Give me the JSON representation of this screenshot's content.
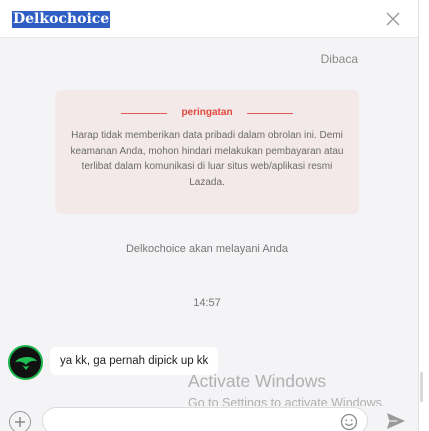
{
  "header": {
    "shop_name": "Delkochoice",
    "close_icon": "close-icon"
  },
  "conversation": {
    "read_status": "Dibaca",
    "warning": {
      "title": "peringatan",
      "text": "Harap tidak memberikan data pribadi dalam obrolan ini. Demi keamanan Anda, mohon hindari melakukan pembayaran atau terlibat dalam komunikasi di luar situs web/aplikasi resmi Lazada."
    },
    "service_note": "Delkochoice akan melayani Anda",
    "timestamp": "14:57",
    "messages": [
      {
        "sender": "customer",
        "text": "ya kk, ga pernah dipick up kk",
        "avatar_icon": "avatar-icon"
      }
    ]
  },
  "watermark": {
    "title": "Activate Windows",
    "subtitle": "Go to Settings to activate Windows."
  },
  "composer": {
    "message_value": "",
    "plus_icon": "plus-icon",
    "emoji_icon": "emoji-icon",
    "send_icon": "send-icon"
  },
  "colors": {
    "warning_accent": "#e0493d",
    "warning_bg": "#f3e9e9",
    "avatar_ring": "#19b34a"
  }
}
